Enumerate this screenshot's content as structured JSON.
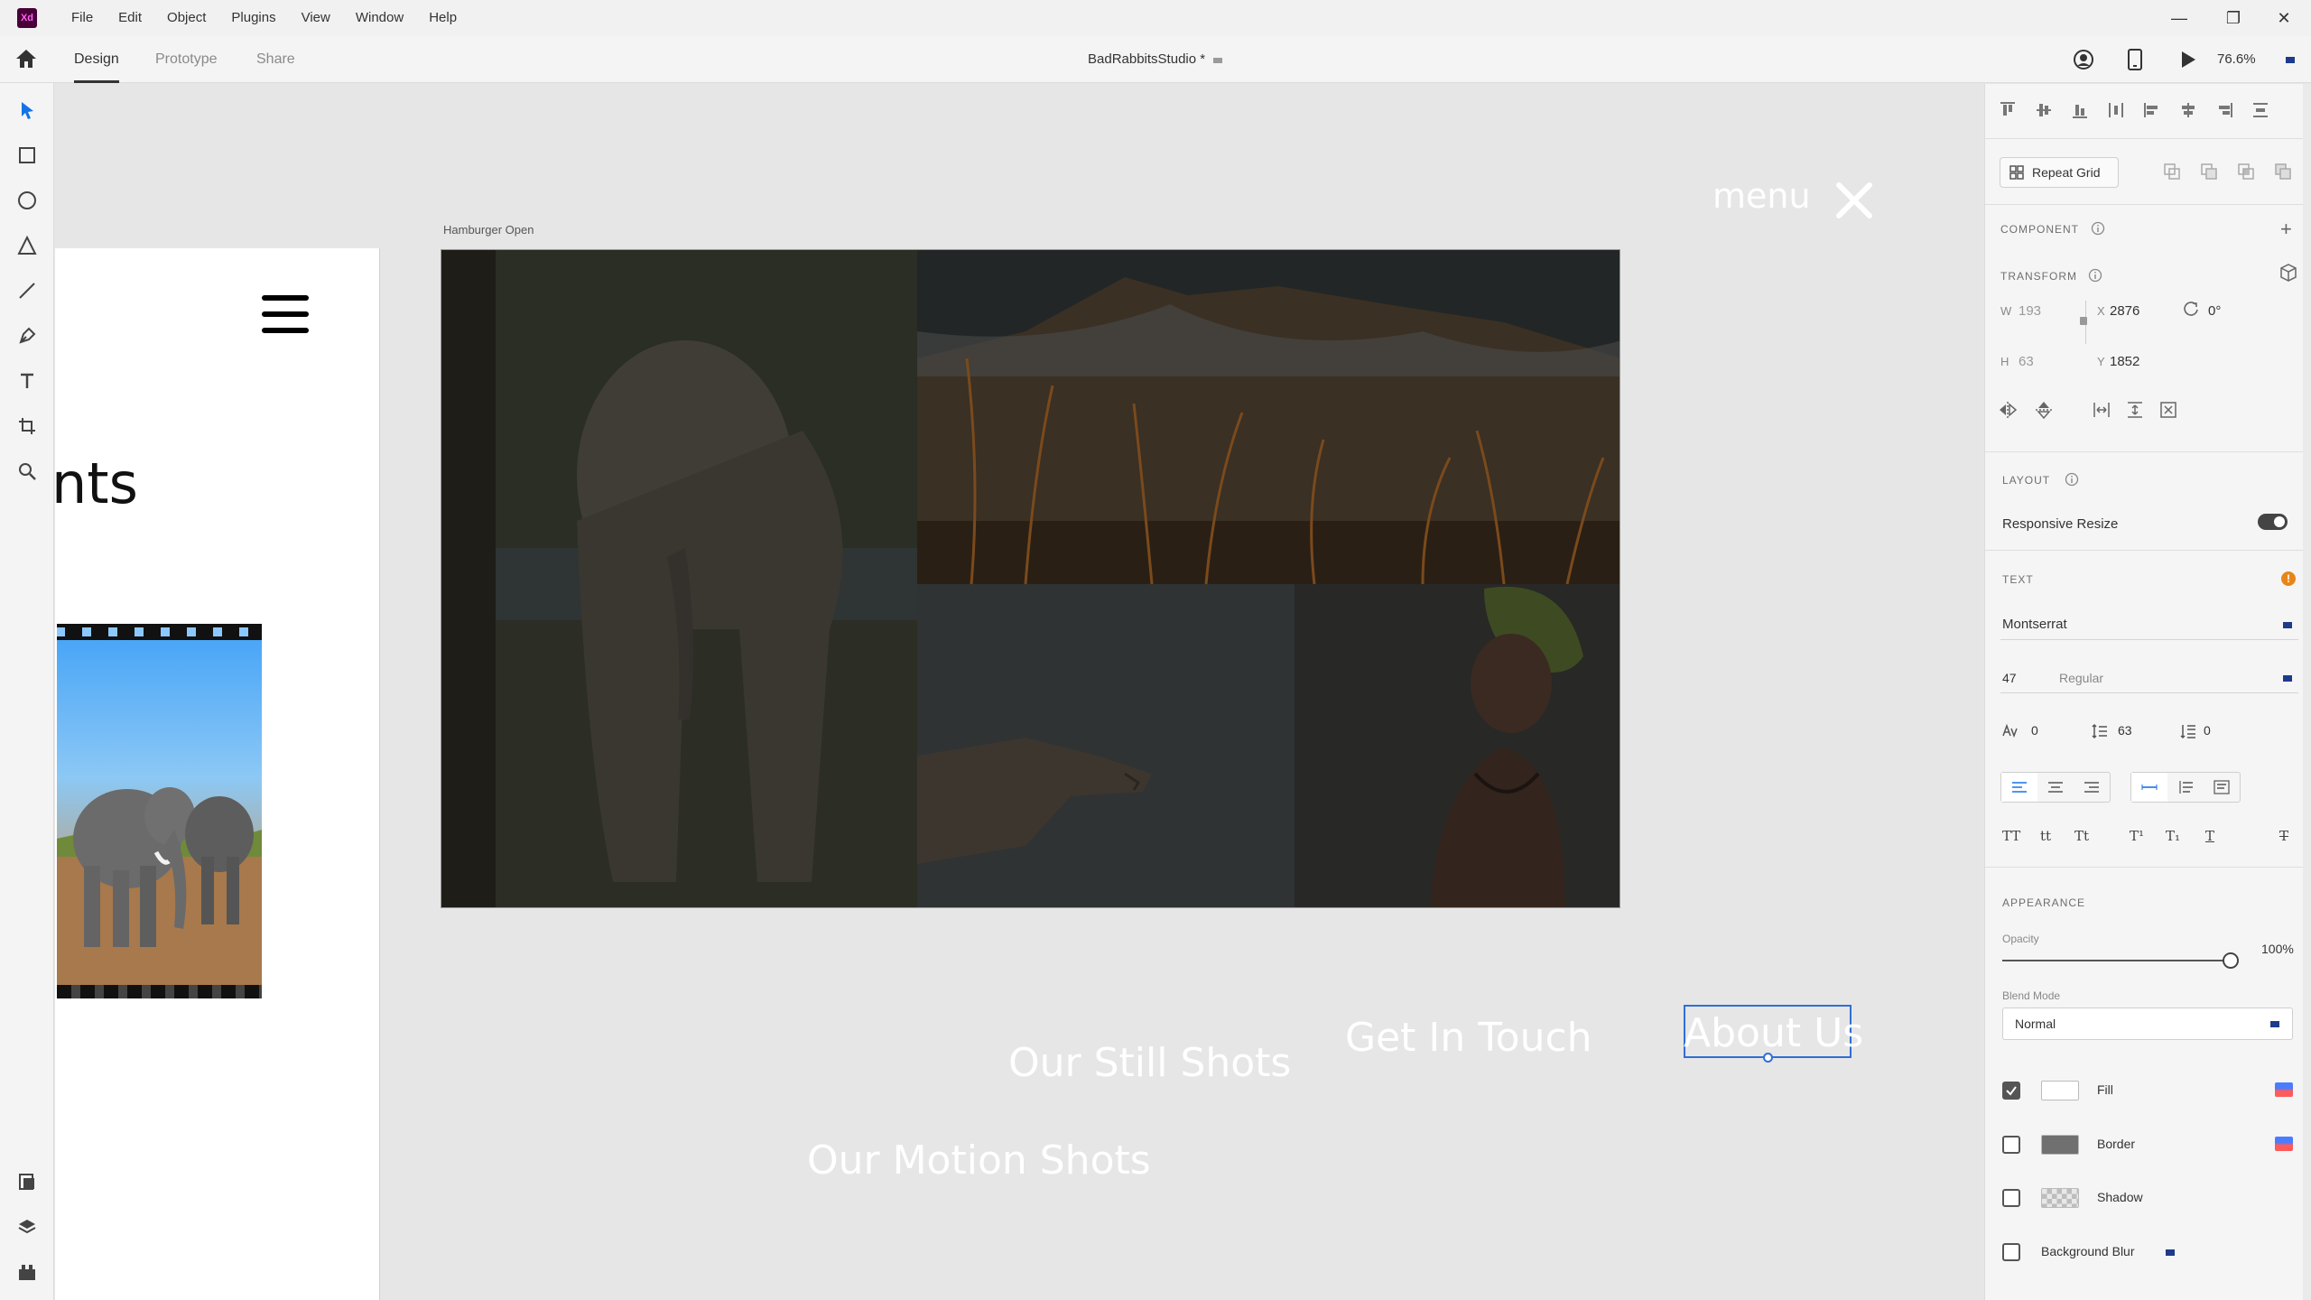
{
  "app": {
    "logo": "Xd",
    "menu": [
      "File",
      "Edit",
      "Object",
      "Plugins",
      "View",
      "Window",
      "Help"
    ],
    "window_controls": {
      "minimize": "—",
      "restore": "❐",
      "close": "✕"
    }
  },
  "modebar": {
    "tabs": [
      "Design",
      "Prototype",
      "Share"
    ],
    "active_tab": "Design",
    "document_title": "BadRabbitsStudio *",
    "zoom": "76.6%"
  },
  "tools": [
    "select-tool",
    "rectangle-tool",
    "ellipse-tool",
    "polygon-tool",
    "line-tool",
    "pen-tool",
    "text-tool",
    "artboard-tool",
    "zoom-tool"
  ],
  "bottom_tools": [
    "assets-panel",
    "layers-panel",
    "plugins-panel"
  ],
  "canvas": {
    "left_artboard": {
      "heading_fragment": "nts"
    },
    "artboard_label": "Hamburger  Open",
    "menu_overlay": {
      "menu_label": "menu",
      "close_glyph": "✕"
    },
    "nav_links": {
      "still": "Our Still Shots",
      "touch": "Get In Touch",
      "about": "About Us",
      "motion": "Our Motion Shots"
    }
  },
  "panel": {
    "repeat_grid": "Repeat Grid",
    "component_title": "COMPONENT",
    "transform_title": "TRANSFORM",
    "transform": {
      "w_label": "W",
      "w": "193",
      "h_label": "H",
      "h": "63",
      "x_label": "X",
      "x": "2876",
      "y_label": "Y",
      "y": "1852",
      "rotation": "0°"
    },
    "layout_title": "LAYOUT",
    "responsive_resize": "Responsive Resize",
    "responsive_resize_on": true,
    "text_title": "TEXT",
    "font_family": "Montserrat",
    "font_size": "47",
    "font_weight": "Regular",
    "char_spacing": "0",
    "line_spacing": "63",
    "paragraph_spacing": "0",
    "text_transforms": [
      "TT",
      "tt",
      "Tt",
      "T¹",
      "T₁",
      "T",
      "T"
    ],
    "appearance_title": "APPEARANCE",
    "opacity_label": "Opacity",
    "opacity": "100%",
    "blend_mode_label": "Blend Mode",
    "blend_mode": "Normal",
    "fill": {
      "label": "Fill",
      "checked": true,
      "color": "#ffffff"
    },
    "border": {
      "label": "Border",
      "checked": false,
      "color": "#707070"
    },
    "shadow": {
      "label": "Shadow",
      "checked": false
    },
    "background_blur": {
      "label": "Background Blur",
      "checked": false
    }
  }
}
